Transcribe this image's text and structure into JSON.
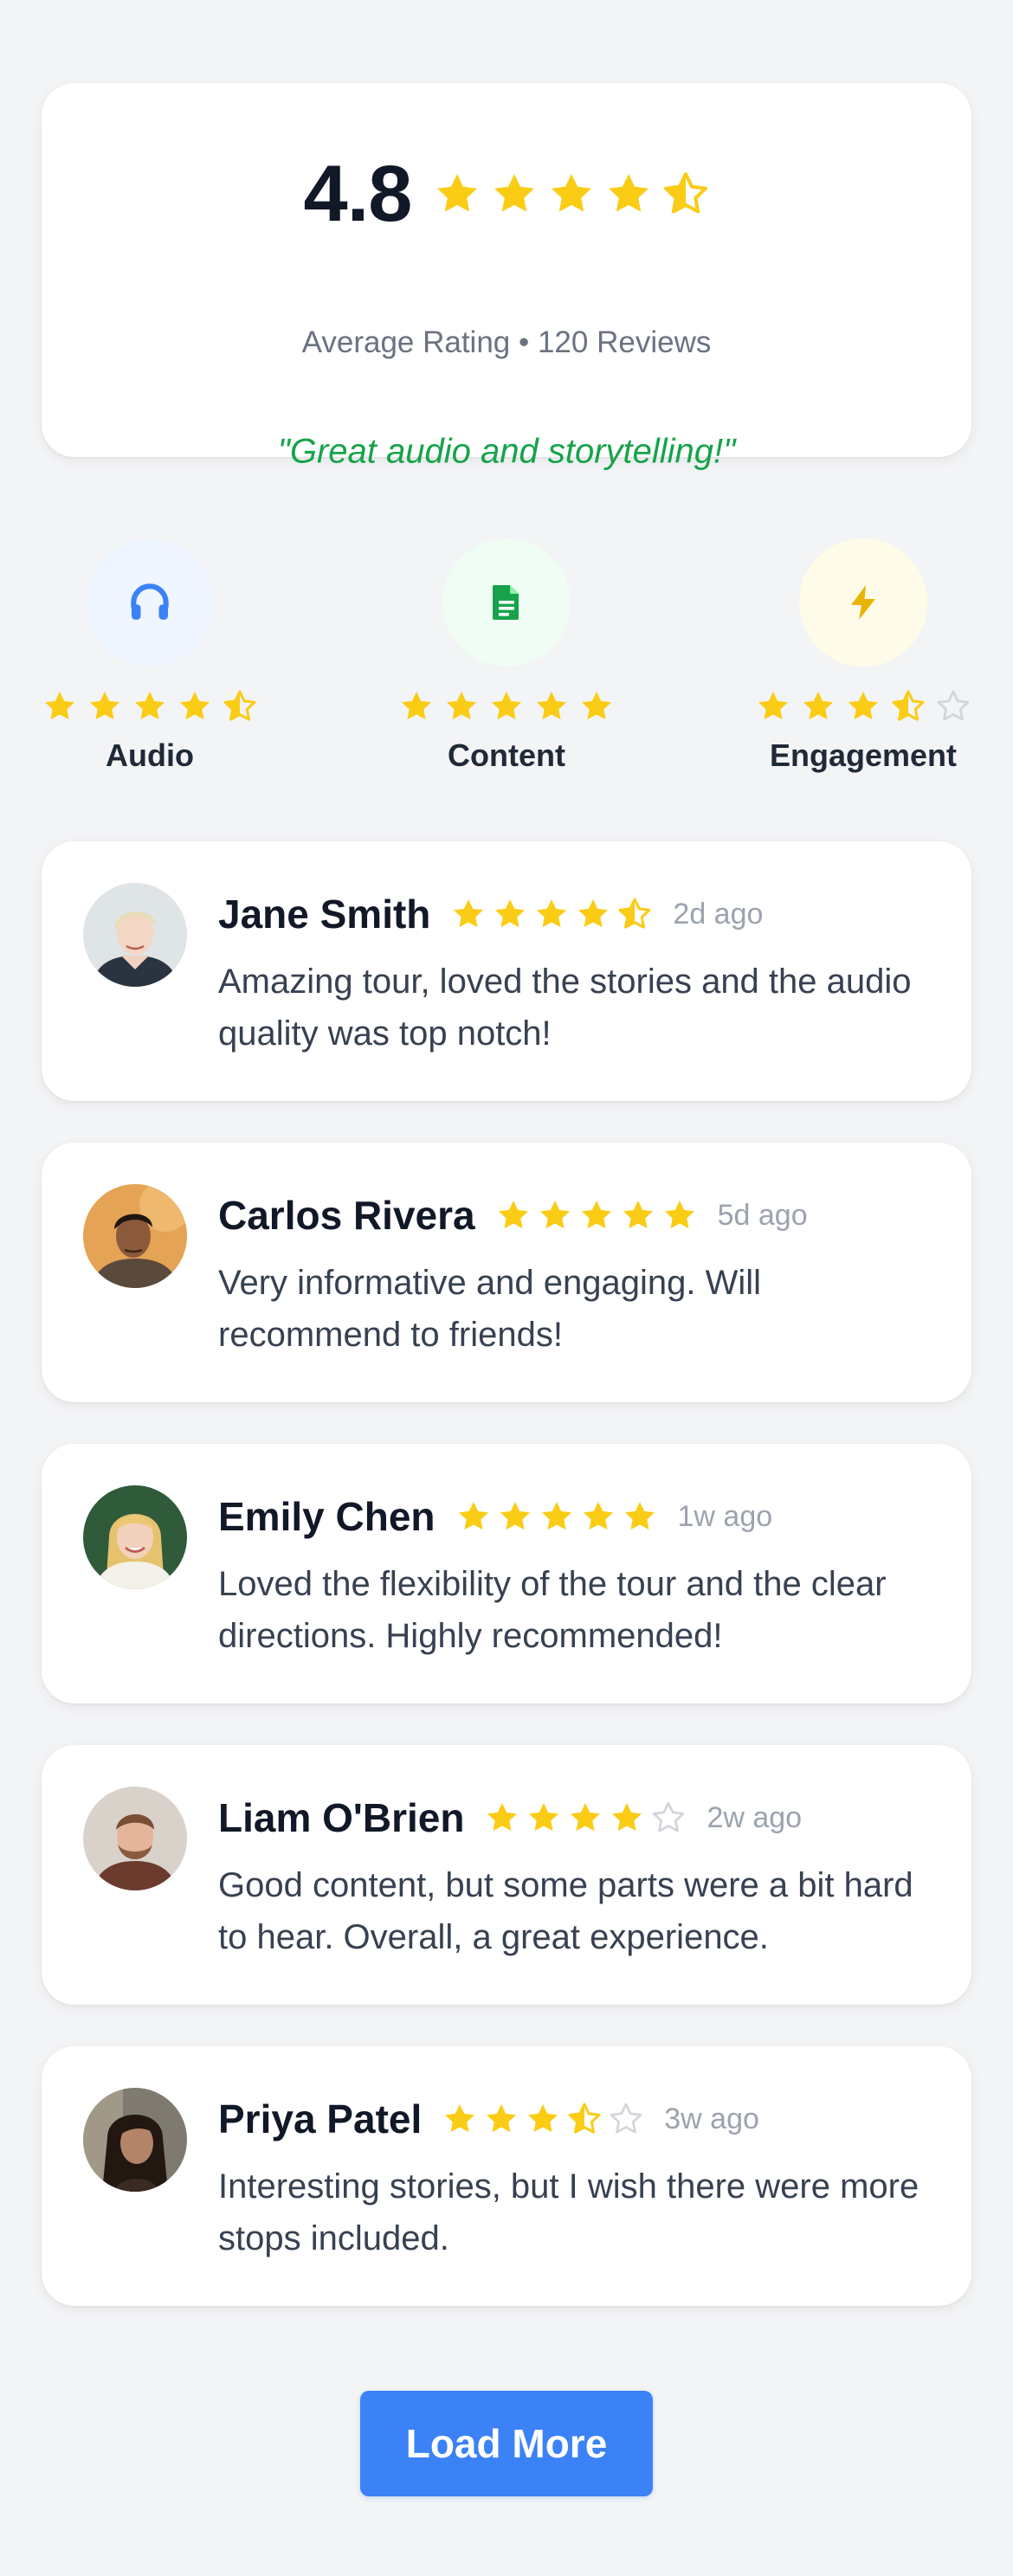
{
  "summary": {
    "rating": "4.8",
    "stars": 4.5,
    "subtitle": "Average Rating • 120 Reviews",
    "quote": "\"Great audio and storytelling!\""
  },
  "categories": [
    {
      "label": "Audio",
      "icon": "headphones-icon",
      "stars": 4.5,
      "icon_color": "#3b82f6",
      "bg_color": "#eff6ff"
    },
    {
      "label": "Content",
      "icon": "document-icon",
      "stars": 5,
      "icon_color": "#16a34a",
      "bg_color": "#f0fdf4"
    },
    {
      "label": "Engagement",
      "icon": "lightning-icon",
      "stars": 3.5,
      "icon_color": "#eab308",
      "bg_color": "#fefce8"
    }
  ],
  "reviews": [
    {
      "name": "Jane Smith",
      "stars": 4.5,
      "time": "2d ago",
      "text": "Amazing tour, loved the stories and the audio quality was top notch!"
    },
    {
      "name": "Carlos Rivera",
      "stars": 5,
      "time": "5d ago",
      "text": "Very informative and engaging. Will recommend to friends!"
    },
    {
      "name": "Emily Chen",
      "stars": 5,
      "time": "1w ago",
      "text": "Loved the flexibility of the tour and the clear directions. Highly recommended!"
    },
    {
      "name": "Liam O'Brien",
      "stars": 4,
      "time": "2w ago",
      "text": "Good content, but some parts were a bit hard to hear. Overall, a great experience."
    },
    {
      "name": "Priya Patel",
      "stars": 3.5,
      "time": "3w ago",
      "text": "Interesting stories, but I wish there were more stops included."
    }
  ],
  "load_more_label": "Load More",
  "colors": {
    "star": "#facc15",
    "star_empty": "#d1d5db",
    "accent": "#3b82f6",
    "quote": "#16a34a"
  }
}
